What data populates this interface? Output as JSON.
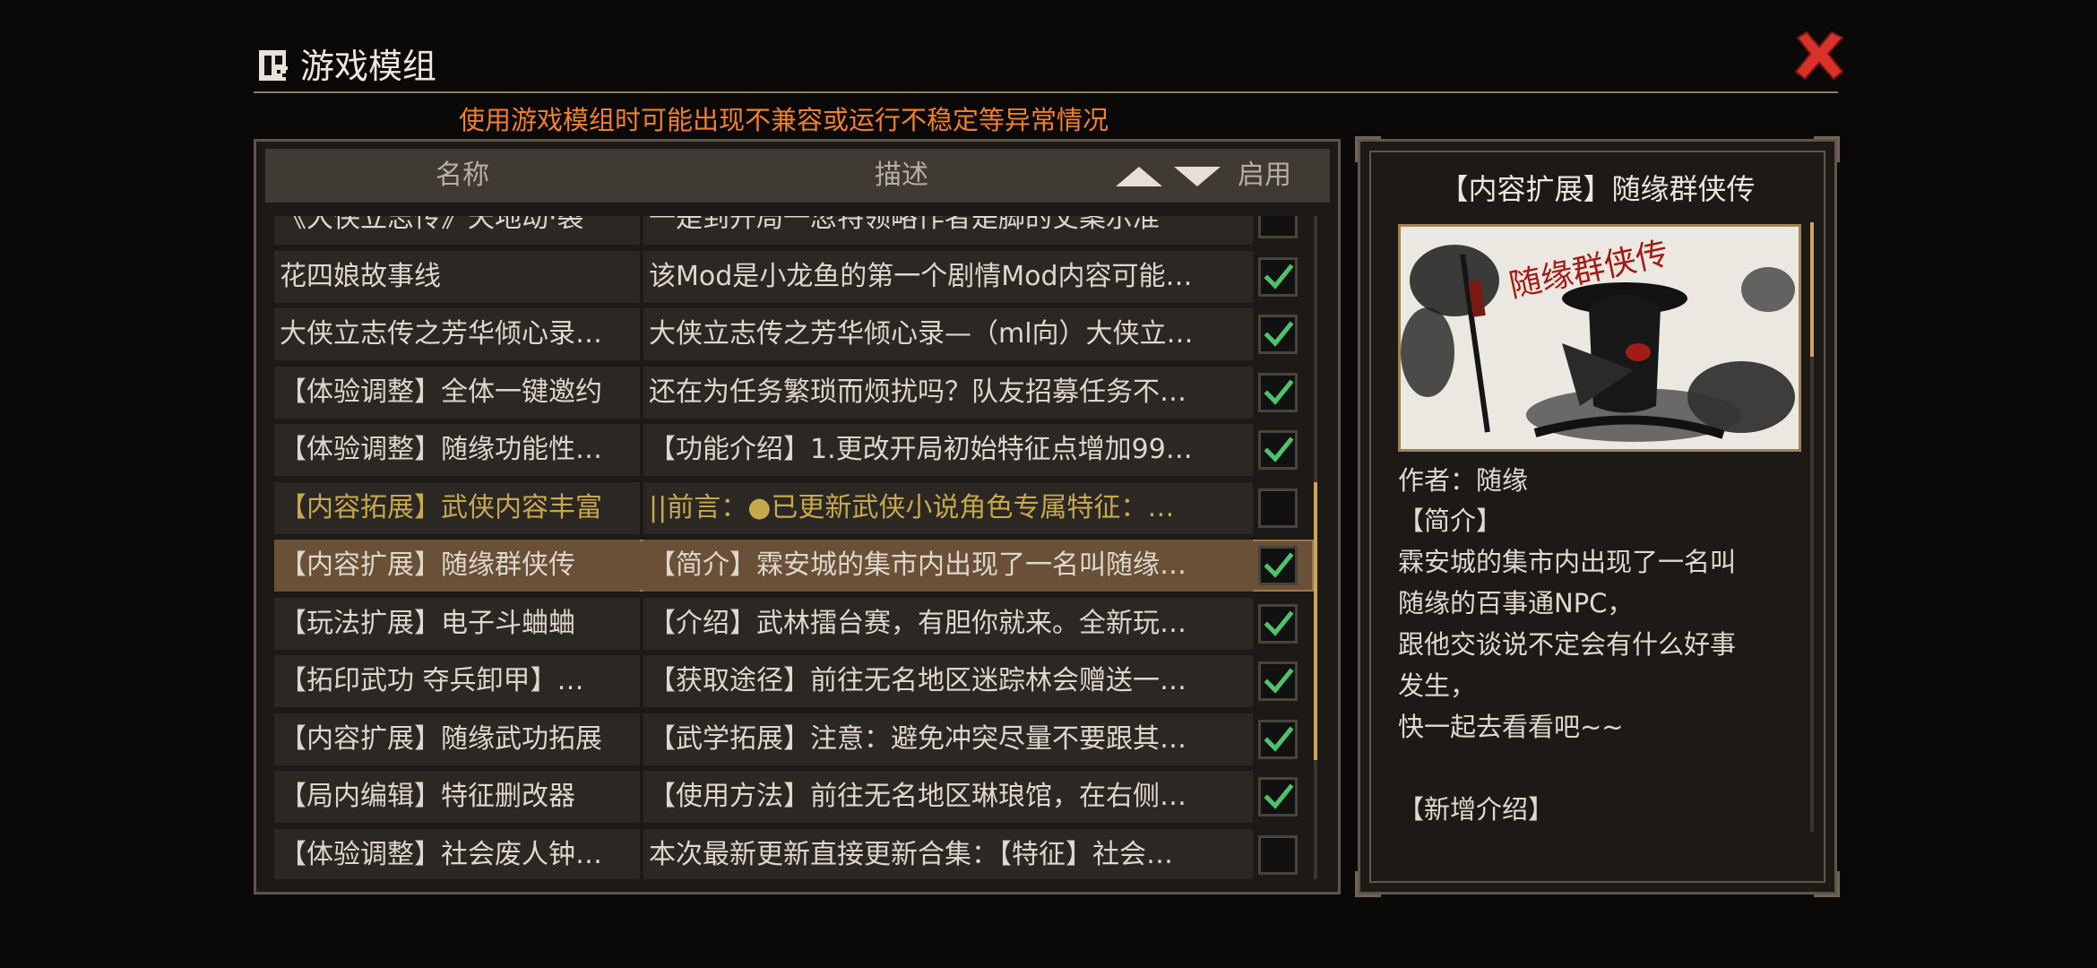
{
  "header": {
    "title": "游戏模组",
    "warning": "使用游戏模组时可能出现不兼容或运行不稳定等异常情况"
  },
  "table": {
    "columns": {
      "name": "名称",
      "description": "描述",
      "enable": "启用"
    },
    "rows": [
      {
        "name": "《大侠立志传》天地动·裂",
        "description": "一是到开局一忽特领略作者是脚的丈案示准",
        "enabled": false,
        "selected": false
      },
      {
        "name": "花四娘故事线",
        "description": "该Mod是小龙鱼的第一个剧情Mod内容可能…",
        "enabled": true,
        "selected": false
      },
      {
        "name": "大侠立志传之芳华倾心录…",
        "description": "大侠立志传之芳华倾心录—（ml向）大侠立…",
        "enabled": true,
        "selected": false
      },
      {
        "name": "【体验调整】全体一键邀约",
        "description": "还在为任务繁琐而烦扰吗？队友招募任务不…",
        "enabled": true,
        "selected": false
      },
      {
        "name": "【体验调整】随缘功能性…",
        "description": "【功能介绍】1.更改开局初始特征点增加99…",
        "enabled": true,
        "selected": false
      },
      {
        "name": "【内容拓展】武侠内容丰富",
        "description": "||前言：●已更新武侠小说角色专属特征：…",
        "enabled": false,
        "selected": false,
        "special": true
      },
      {
        "name": "【内容扩展】随缘群侠传",
        "description": "【简介】霖安城的集市内出现了一名叫随缘…",
        "enabled": true,
        "selected": true
      },
      {
        "name": "【玩法扩展】电子斗蛐蛐",
        "description": "【介绍】武林擂台赛，有胆你就来。全新玩…",
        "enabled": true,
        "selected": false
      },
      {
        "name": "【拓印武功 夺兵卸甲】…",
        "description": "【获取途径】前往无名地区迷踪林会赠送一…",
        "enabled": true,
        "selected": false
      },
      {
        "name": "【内容扩展】随缘武功拓展",
        "description": "【武学拓展】注意：避免冲突尽量不要跟其…",
        "enabled": true,
        "selected": false
      },
      {
        "name": "【局内编辑】特征删改器",
        "description": "【使用方法】前往无名地区琳琅馆，在右侧…",
        "enabled": true,
        "selected": false
      },
      {
        "name": "【体验调整】社会废人钟…",
        "description": "本次最新更新直接更新合集：【特征】社会…",
        "enabled": false,
        "selected": false
      }
    ]
  },
  "detail": {
    "title": "【内容扩展】随缘群侠传",
    "image_text": "随缘群侠传",
    "author": "作者：随缘",
    "lines": [
      "【简介】",
      "霖安城的集市内出现了一名叫",
      "随缘的百事通NPC，",
      "跟他交谈说不定会有什么好事",
      "发生，",
      "快一起去看看吧~~",
      "",
      "【新增介绍】"
    ]
  },
  "colors": {
    "accent": "#c9a55c",
    "warning": "#f07f2c",
    "check": "#4fc26a",
    "close": "#d8322b"
  }
}
